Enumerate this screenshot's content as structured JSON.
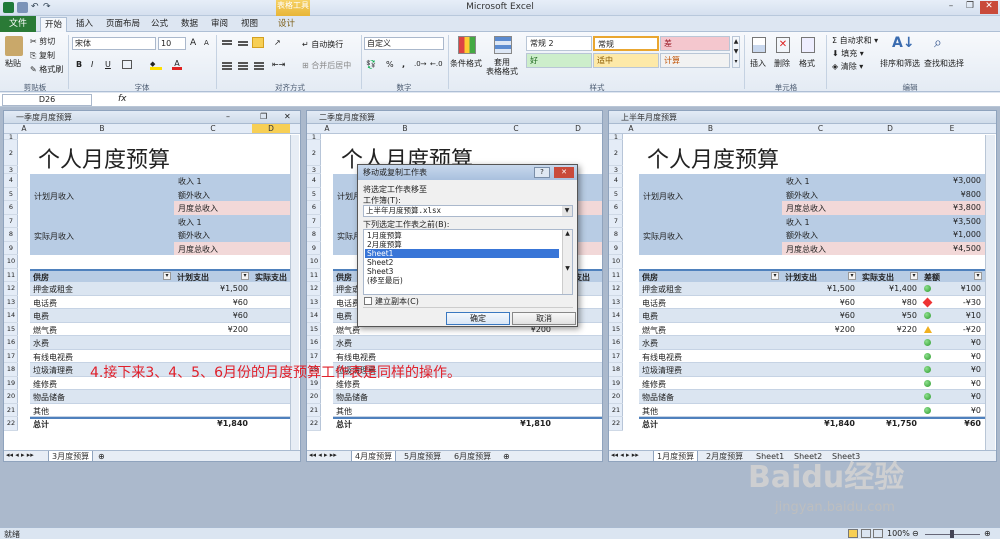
{
  "app": {
    "title": "Microsoft Excel",
    "context_tab": "表格工具"
  },
  "ribbon_tabs": [
    "文件",
    "开始",
    "插入",
    "页面布局",
    "公式",
    "数据",
    "审阅",
    "视图",
    "设计"
  ],
  "clipboard": {
    "paste": "粘贴",
    "cut": "剪切",
    "copy": "复制",
    "format_painter": "格式刷",
    "group": "剪贴板"
  },
  "font": {
    "name": "宋体",
    "size": "10",
    "group": "字体",
    "bold": "B",
    "italic": "I",
    "underline": "U",
    "grow": "A",
    "shrink": "A"
  },
  "alignment": {
    "wrap": "自动换行",
    "merge": "合并后居中",
    "group": "对齐方式"
  },
  "number": {
    "format": "自定义",
    "group": "数字",
    "percent": "%",
    "comma": ","
  },
  "styles": {
    "cond_format": "条件格式",
    "table_format": "套用\n表格格式",
    "group": "样式",
    "cells": [
      {
        "label": "常规 2",
        "bg": "#ffffff"
      },
      {
        "label": "常规",
        "bg": "#ffffff"
      },
      {
        "label": "差",
        "bg": "#f4c7ce"
      },
      {
        "label": "好",
        "bg": "#cdeecb"
      },
      {
        "label": "适中",
        "bg": "#fde9a8"
      },
      {
        "label": "计算",
        "bg": "#f2f2f2"
      }
    ]
  },
  "cells_group": {
    "insert": "插入",
    "delete": "删除",
    "format": "格式",
    "group": "单元格"
  },
  "editing": {
    "autosum": "自动求和",
    "fill": "填充",
    "clear": "清除",
    "sort": "排序和筛选",
    "find": "查找和选择",
    "group": "编辑"
  },
  "formula_bar": {
    "name_box": "D26",
    "fx": "fx",
    "value": ""
  },
  "windows": [
    {
      "title": "一季度月度预算",
      "tabs": [
        "3月度预算"
      ],
      "active_tab": "3月度预算"
    },
    {
      "title": "二季度月度预算",
      "tabs": [
        "4月度预算",
        "5月度预算",
        "6月度预算"
      ],
      "active_tab": "4月度预算"
    },
    {
      "title": "上半年月度预算",
      "tabs": [
        "1月度预算",
        "2月度预算",
        "Sheet1",
        "Sheet2",
        "Sheet3"
      ],
      "active_tab": "1月度预算"
    }
  ],
  "sheet": {
    "title": "个人月度预算",
    "col_letters": [
      "A",
      "B",
      "C",
      "D",
      "E"
    ],
    "planned_income_label": "计划月收入",
    "actual_income_label": "实际月收入",
    "income_rows": [
      "收入 1",
      "额外收入",
      "月度总收入"
    ],
    "planned_income_values": [
      "¥3,000",
      "¥800",
      "¥3,800"
    ],
    "actual_income_values": [
      "¥3,500",
      "¥1,000",
      "¥4,500"
    ],
    "headers": [
      "供房",
      "计划支出",
      "实际支出",
      "差额"
    ],
    "items": [
      {
        "name": "押金或租金",
        "plan": "¥1,500",
        "actual": "¥1,400",
        "diff": "¥100",
        "flag": "good"
      },
      {
        "name": "电话费",
        "plan": "¥60",
        "actual": "¥80",
        "diff": "-¥30",
        "flag": "bad"
      },
      {
        "name": "电费",
        "plan": "¥60",
        "actual": "¥50",
        "diff": "¥10",
        "flag": "good"
      },
      {
        "name": "燃气费",
        "plan": "¥200",
        "actual": "¥220",
        "diff": "-¥20",
        "flag": "warn"
      },
      {
        "name": "水费",
        "plan": "",
        "actual": "",
        "diff": "¥0",
        "flag": "good"
      },
      {
        "name": "有线电视费",
        "plan": "",
        "actual": "",
        "diff": "¥0",
        "flag": "good"
      },
      {
        "name": "垃圾清理费",
        "plan": "",
        "actual": "",
        "diff": "¥0",
        "flag": "good"
      },
      {
        "name": "维修费",
        "plan": "",
        "actual": "",
        "diff": "¥0",
        "flag": "good"
      },
      {
        "name": "物品储备",
        "plan": "",
        "actual": "",
        "diff": "¥0",
        "flag": "good"
      },
      {
        "name": "其他",
        "plan": "",
        "actual": "",
        "diff": "¥0",
        "flag": "good"
      }
    ],
    "total_label": "总计",
    "total_plan": "¥1,840",
    "total_plan_2": "¥1,810",
    "total_actual": "¥1,750",
    "total_diff": "¥60"
  },
  "dialog": {
    "title": "移动或复制工作表",
    "move_to": "将选定工作表移至",
    "workbook_label": "工作簿(T):",
    "workbook_value": "上半年月度预算.xlsx",
    "before_label": "下列选定工作表之前(B):",
    "sheets": [
      "1月度预算",
      "2月度预算",
      "Sheet1",
      "Sheet2",
      "Sheet3",
      "(移至最后)"
    ],
    "selected": "Sheet1",
    "copy_label": "建立副本(C)",
    "ok": "确定",
    "cancel": "取消",
    "help": "?",
    "close": "✕"
  },
  "annotation": "4.接下来3、4、5、6月份的月度预算工作表是同样的操作。",
  "status": {
    "ready": "就绪",
    "zoom": "100%"
  },
  "watermark": {
    "logo": "Baidu经验",
    "url": "jingyan.baidu.com"
  }
}
